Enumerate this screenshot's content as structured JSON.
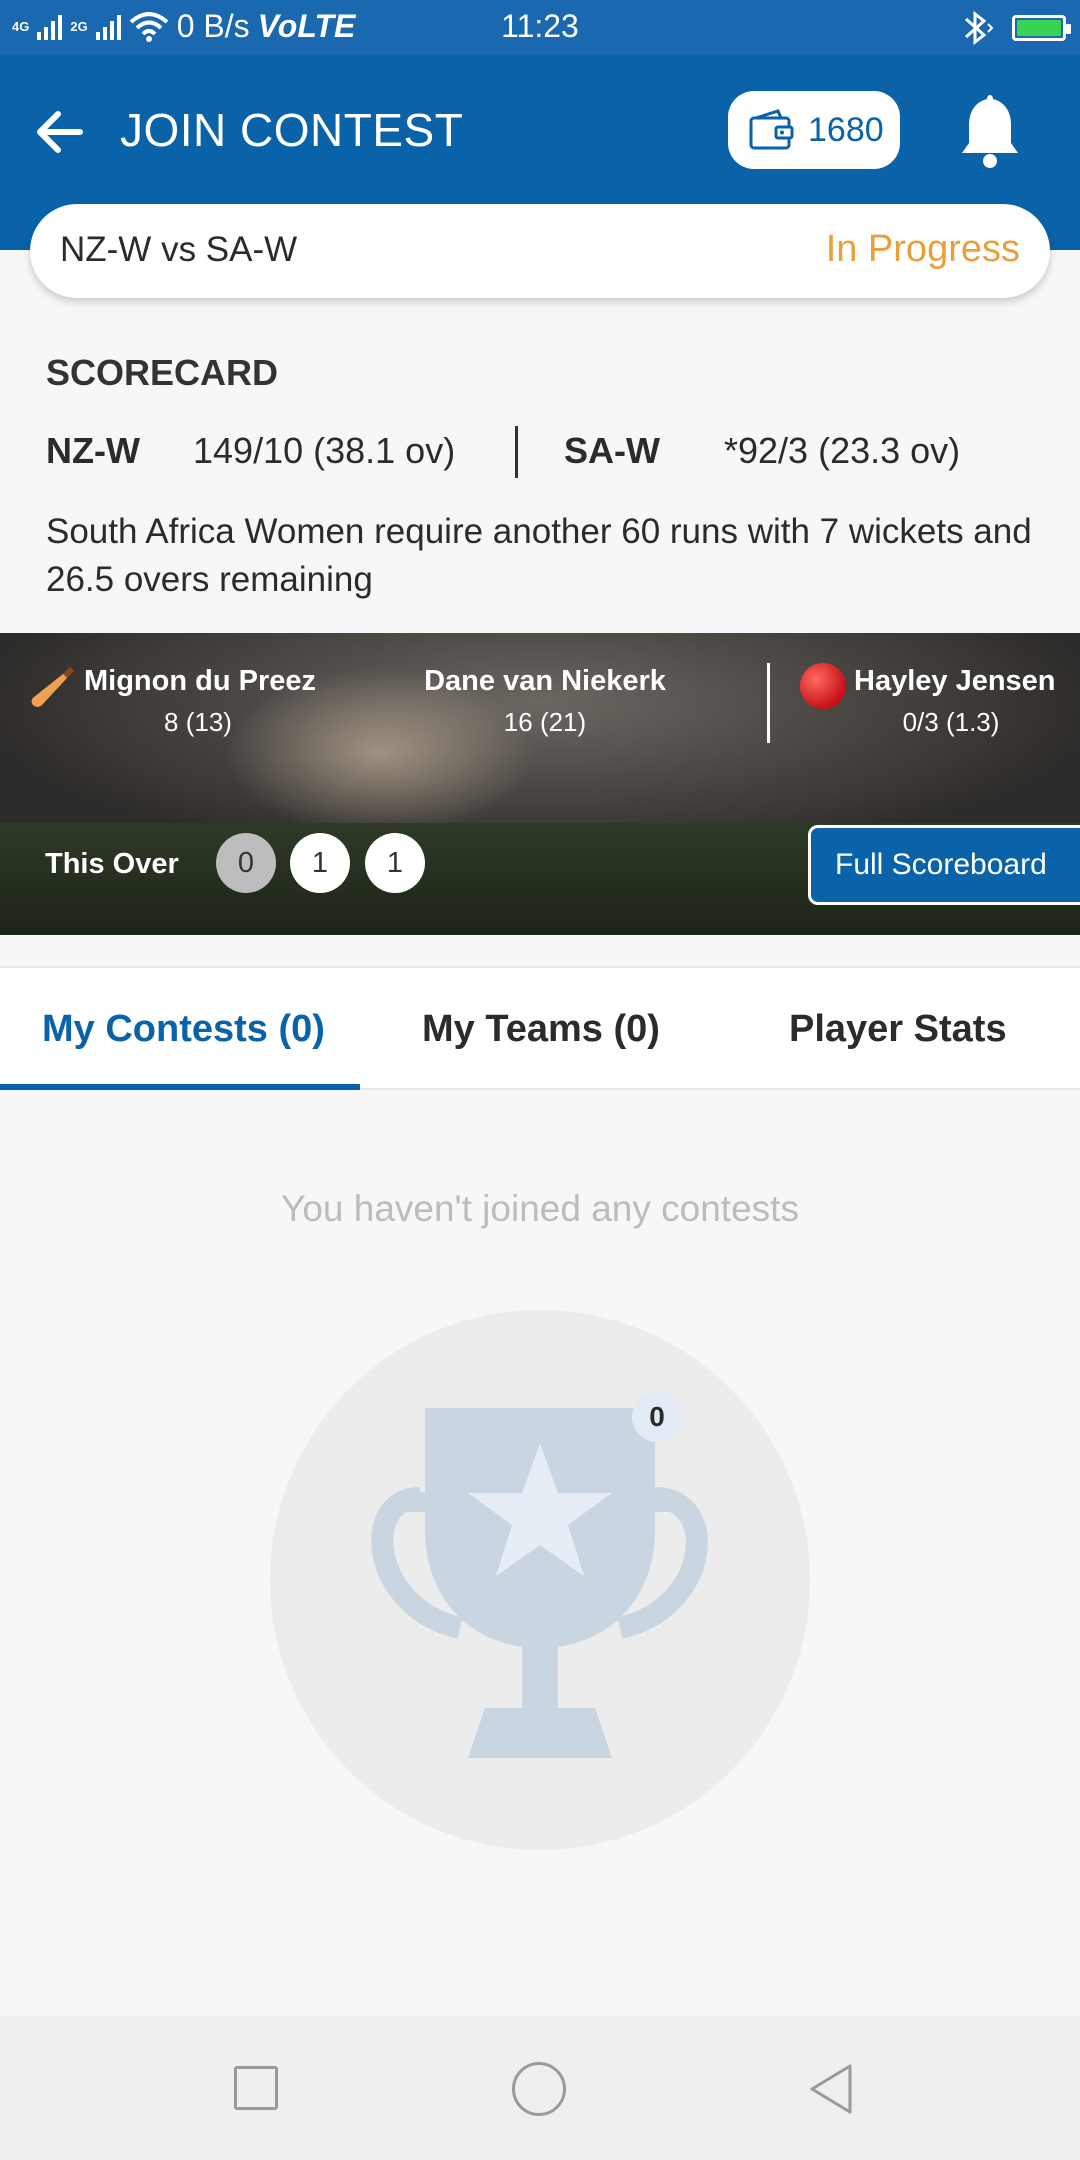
{
  "status_bar": {
    "network1": "4G",
    "network2": "2G",
    "speed": "0 B/s",
    "volte": "VoLTE",
    "time": "11:23"
  },
  "header": {
    "title": "JOIN CONTEST",
    "wallet_balance": "1680"
  },
  "match": {
    "name": "NZ-W vs SA-W",
    "status": "In Progress"
  },
  "scorecard": {
    "title": "SCORECARD",
    "team1": "NZ-W",
    "team1_score": "149/10 (38.1 ov)",
    "team2": "SA-W",
    "team2_score": "*92/3 (23.3 ov)",
    "summary": "South Africa Women require another 60 runs with 7 wickets and 26.5 overs remaining"
  },
  "live": {
    "batsman1_name": "Mignon du Preez",
    "batsman1_score": "8 (13)",
    "batsman2_name": "Dane van Niekerk",
    "batsman2_score": "16 (21)",
    "bowler_name": "Hayley Jensen",
    "bowler_figures": "0/3 (1.3)",
    "this_over_label": "This Over",
    "balls": [
      "0",
      "1",
      "1"
    ],
    "full_scoreboard_label": "Full Scoreboard"
  },
  "tabs": [
    {
      "label": "My Contests (0)",
      "active": true
    },
    {
      "label": "My Teams (0)",
      "active": false
    },
    {
      "label": "Player Stats",
      "active": false
    }
  ],
  "empty_state": {
    "message": "You haven't joined any contests",
    "badge_count": "0"
  },
  "colors": {
    "primary": "#0a62a8",
    "status_bar": "#1a68b0",
    "in_progress": "#e8a03a",
    "background": "#f7f7f7"
  }
}
